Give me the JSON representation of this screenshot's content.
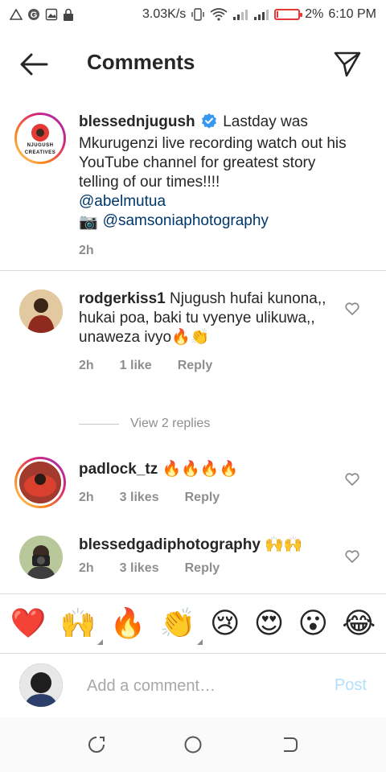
{
  "status_bar": {
    "speed": "3.03K/s",
    "battery": "2%",
    "time": "6:10 PM"
  },
  "header": {
    "title": "Comments"
  },
  "caption": {
    "username": "blessednjugush",
    "text_part1": "Lastday was Mkurugenzi live recording watch out his YouTube channel for greatest story telling of our times!!!!",
    "mention1": "@abelmutua",
    "mention2": "@samsoniaphotography",
    "camera_emoji": "📷",
    "time": "2h",
    "avatar_logo_line1": "NJUGUSH",
    "avatar_logo_line2": "CREATIVES"
  },
  "comments": [
    {
      "username": "rodgerkiss1",
      "text": "Njugush hufai kunona,, hukai poa, baki tu vyenye ulikuwa,, unaweza ivyo🔥👏",
      "time": "2h",
      "likes": "1 like",
      "reply_label": "Reply"
    },
    {
      "username": "padlock_tz",
      "text": "🔥🔥🔥🔥",
      "time": "2h",
      "likes": "3 likes",
      "reply_label": "Reply"
    },
    {
      "username": "blessedgadiphotography",
      "text": "🙌🙌",
      "time": "2h",
      "likes": "3 likes",
      "reply_label": "Reply"
    }
  ],
  "view_replies": "View 2 replies",
  "emoji_bar": [
    "❤️",
    "🙌",
    "🔥",
    "👏",
    "😢",
    "😍",
    "😮",
    "😂"
  ],
  "add_comment": {
    "placeholder": "Add a comment…",
    "post_label": "Post"
  },
  "colors": {
    "mention": "#00376b",
    "post_disabled": "#b2dffc",
    "meta_gray": "#8e8e8e",
    "battery_low": "#e53935"
  }
}
